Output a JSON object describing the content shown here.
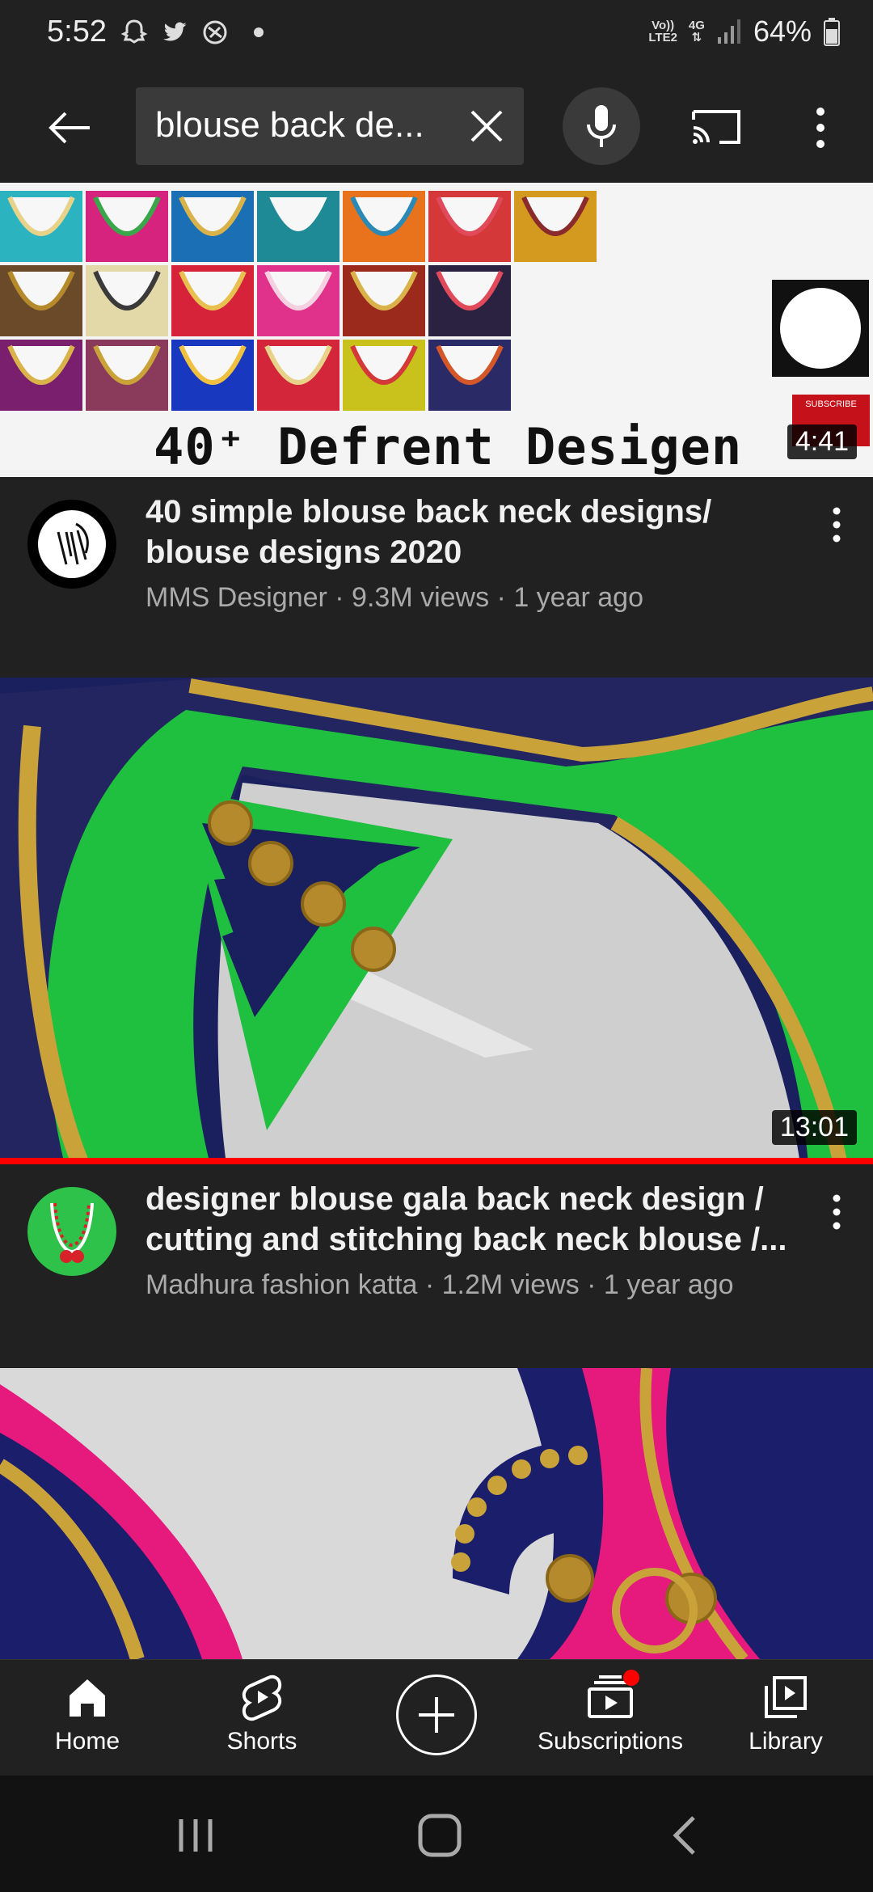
{
  "status": {
    "time": "5:52",
    "network_line1": "Vo))",
    "network_line2": "LTE2",
    "net_type": "4G",
    "battery": "64%"
  },
  "search": {
    "query": "blouse back de..."
  },
  "videos": [
    {
      "thumb_caption": "40⁺ Defrent Desigen",
      "duration": "4:41",
      "title": "40 simple blouse back neck designs/ blouse designs 2020",
      "meta": "MMS Designer · 9.3M views · 1 year ago",
      "badge_text": "SUBSCRIBE"
    },
    {
      "duration": "13:01",
      "title": "designer blouse gala back neck design / cutting and stitching back neck blouse /...",
      "meta": "Madhura fashion katta · 1.2M views · 1 year ago",
      "watch_progress": 1.0
    },
    {}
  ],
  "nav": {
    "home": "Home",
    "shorts": "Shorts",
    "subscriptions": "Subscriptions",
    "library": "Library"
  },
  "colors": {
    "accent": "#ff0000",
    "background": "#212121"
  }
}
